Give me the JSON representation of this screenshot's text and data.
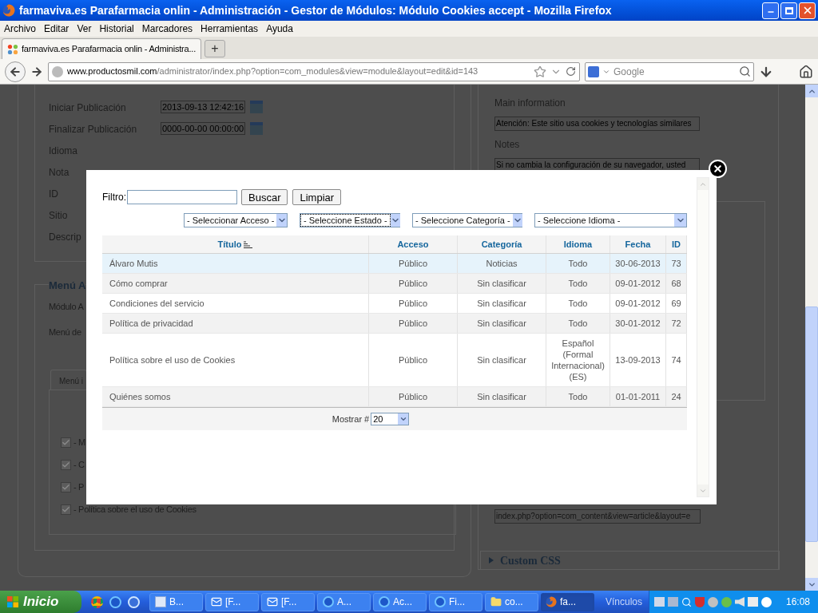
{
  "window": {
    "title": "farmaviva.es Parafarmacia onlin - Administración - Gestor de Módulos: Módulo Cookies accept - Mozilla Firefox"
  },
  "menu": [
    "Archivo",
    "Editar",
    "Ver",
    "Historial",
    "Marcadores",
    "Herramientas",
    "Ayuda"
  ],
  "tabs": [
    {
      "label": "farmaviva.es Parafarmacia onlin - Administra...",
      "selected": true
    }
  ],
  "new_tab": "+",
  "url": {
    "host": "www.productosmil.com",
    "path": "/administrator/index.php?option=com_modules&view=module&layout=edit&id=143"
  },
  "search": {
    "placeholder": "Google"
  },
  "left_form": {
    "fields": [
      {
        "label": "Iniciar Publicación",
        "value": "2013-09-13 12:42:16",
        "kind": "date"
      },
      {
        "label": "Finalizar Publicación",
        "value": "0000-00-00 00:00:00",
        "kind": "date"
      },
      {
        "label": "Idioma",
        "kind": "plain"
      },
      {
        "label": "Nota",
        "kind": "plain"
      },
      {
        "label": "ID",
        "kind": "plain"
      },
      {
        "label": "Sitio",
        "kind": "plain"
      },
      {
        "label": "Descrip",
        "kind": "plain"
      }
    ]
  },
  "menu_section": {
    "legend": "Menú A",
    "fields": [
      "Módulo A",
      "Menú de"
    ],
    "tab": "Menú i",
    "items": [
      {
        "label": "- M",
        "checked": true
      },
      {
        "label": "- C",
        "checked": true
      },
      {
        "label": "- P",
        "checked": true
      },
      {
        "label": "- Política sobre el uso de Cookies",
        "checked": true
      }
    ]
  },
  "right_form": {
    "fields": [
      {
        "label": "Main information",
        "value": "Atención: Este sitio usa cookies y tecnologías similares"
      },
      {
        "label": "Notes",
        "value": "Si no cambia la configuración de su navegador, usted"
      }
    ],
    "link_value": "index.php?option=com_content&view=article&layout=e",
    "section": {
      "title": "Custom CSS",
      "expanded": false
    }
  },
  "modal": {
    "filter_label": "Filtro:",
    "buttons": [
      "Buscar",
      "Limpiar"
    ],
    "selects": [
      {
        "value": "- Seleccionar Acceso -",
        "focused": false
      },
      {
        "value": "- Seleccione Estado -",
        "focused": true
      },
      {
        "value": "- Seleccione Categoría -",
        "focused": false
      },
      {
        "value": "- Seleccione Idioma -",
        "focused": false
      }
    ],
    "columns": [
      {
        "label": "Título",
        "sorted": true
      },
      {
        "label": "Acceso",
        "sorted": false
      },
      {
        "label": "Categoría",
        "sorted": false
      },
      {
        "label": "Idioma",
        "sorted": false
      },
      {
        "label": "Fecha",
        "sorted": false
      },
      {
        "label": "ID",
        "sorted": false
      }
    ],
    "rows": [
      {
        "cells": [
          "Álvaro Mutis",
          "Público",
          "Noticias",
          "Todo",
          "30-06-2013",
          "73"
        ],
        "selected": true
      },
      {
        "cells": [
          "Cómo comprar",
          "Público",
          "Sin clasificar",
          "Todo",
          "09-01-2012",
          "68"
        ],
        "selected": false
      },
      {
        "cells": [
          "Condiciones del servicio",
          "Público",
          "Sin clasificar",
          "Todo",
          "09-01-2012",
          "69"
        ],
        "selected": false
      },
      {
        "cells": [
          "Política de privacidad",
          "Público",
          "Sin clasificar",
          "Todo",
          "30-01-2012",
          "72"
        ],
        "selected": false
      },
      {
        "cells": [
          "Política sobre el uso de Cookies",
          "Público",
          "Sin clasificar",
          "Español (Formal Internacional) (ES)",
          "13-09-2013",
          "74"
        ],
        "selected": false
      },
      {
        "cells": [
          "Quiénes somos",
          "Público",
          "Sin clasificar",
          "Todo",
          "01-01-2011",
          "24"
        ],
        "selected": false
      }
    ],
    "footer": {
      "label": "Mostrar #",
      "value": "20"
    }
  },
  "taskbar": {
    "start": "Inicio",
    "tasks": [
      {
        "label": "B...",
        "kind": "app",
        "selected": false
      },
      {
        "label": "[F...",
        "kind": "mail",
        "selected": false
      },
      {
        "label": "[F...",
        "kind": "mail",
        "selected": false
      },
      {
        "label": "A...",
        "kind": "ie",
        "selected": false
      },
      {
        "label": "Ac...",
        "kind": "ie",
        "selected": false
      },
      {
        "label": "Fi...",
        "kind": "ie",
        "selected": false
      },
      {
        "label": "co...",
        "kind": "folder",
        "selected": false
      },
      {
        "label": "fa...",
        "kind": "firefox",
        "selected": true
      }
    ],
    "links": "Vínculos",
    "clock": "16:08"
  }
}
